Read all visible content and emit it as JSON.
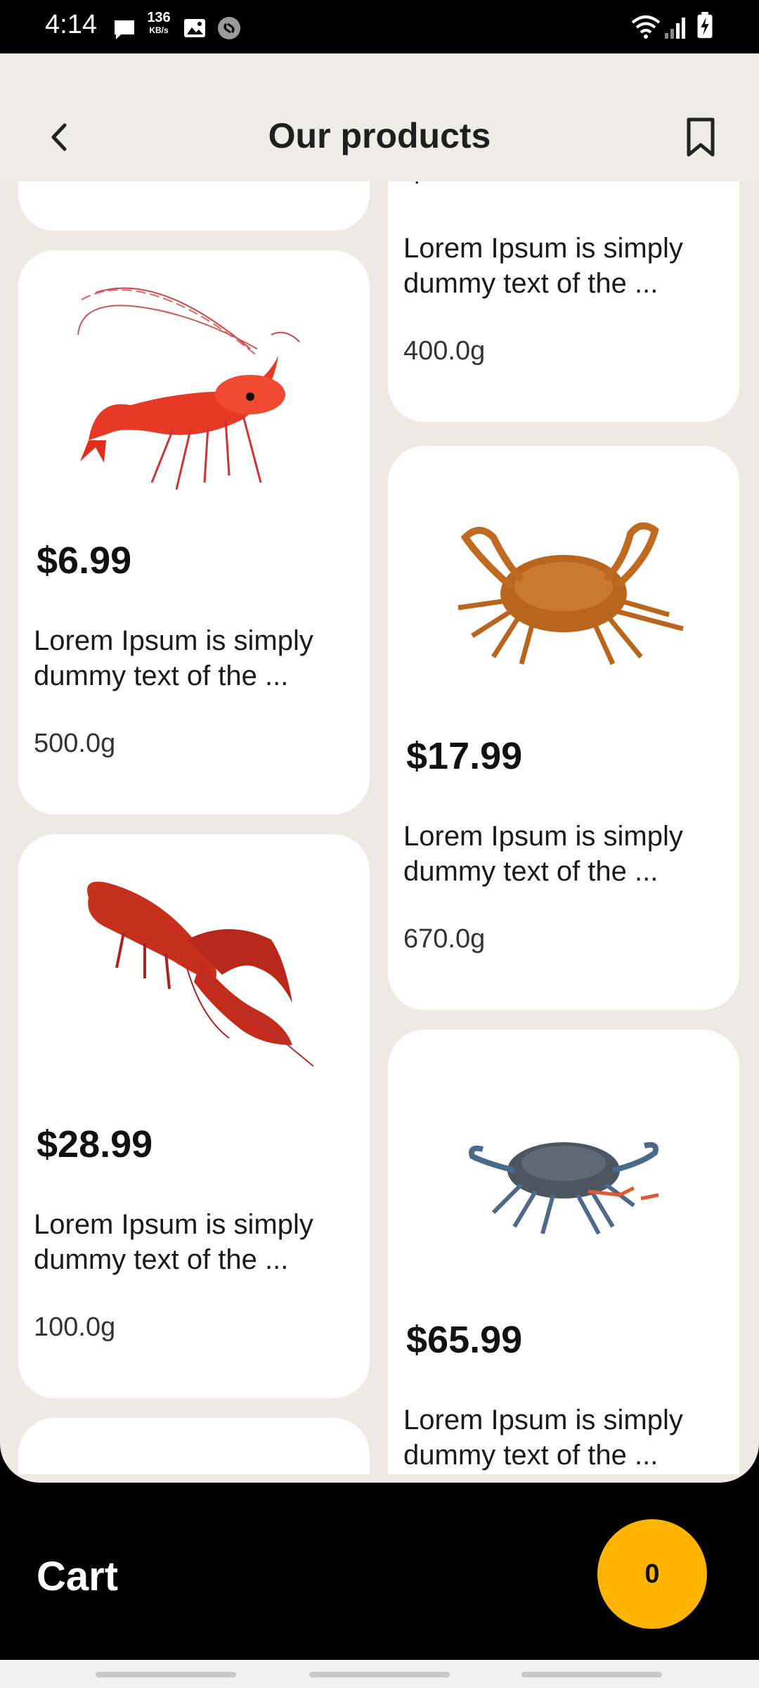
{
  "status_bar": {
    "time": "4:14",
    "net_speed_value": "136",
    "net_speed_unit": "KB/s",
    "icons": [
      "message-icon",
      "net-speed",
      "gallery-icon",
      "shazam-icon",
      "wifi-icon",
      "signal-icon",
      "battery-charging-icon"
    ]
  },
  "header": {
    "title": "Our products",
    "back_icon": "chevron-left-icon",
    "bookmark_icon": "bookmark-icon"
  },
  "products": {
    "left": [
      {
        "name": "shrimp",
        "price": "$6.99",
        "description": "Lorem Ipsum is simply dummy text of the ...",
        "weight": "500.0g"
      },
      {
        "name": "lobster",
        "price": "$28.99",
        "description": "Lorem Ipsum is simply dummy text of the ...",
        "weight": "100.0g"
      }
    ],
    "right": [
      {
        "name": "partial-top",
        "price": "$4.99",
        "description": "Lorem Ipsum is simply dummy text of the ...",
        "weight": "400.0g"
      },
      {
        "name": "brown-crab",
        "price": "$17.99",
        "description": "Lorem Ipsum is simply dummy text of the ...",
        "weight": "670.0g"
      },
      {
        "name": "blue-crab",
        "price": "$65.99",
        "description": "Lorem Ipsum is simply dummy text of the ...",
        "weight": ""
      }
    ]
  },
  "cart": {
    "label": "Cart",
    "count": "0"
  },
  "colors": {
    "background": "#ECEAE2",
    "accent": "#FFB400",
    "card": "#FFFFFF"
  }
}
